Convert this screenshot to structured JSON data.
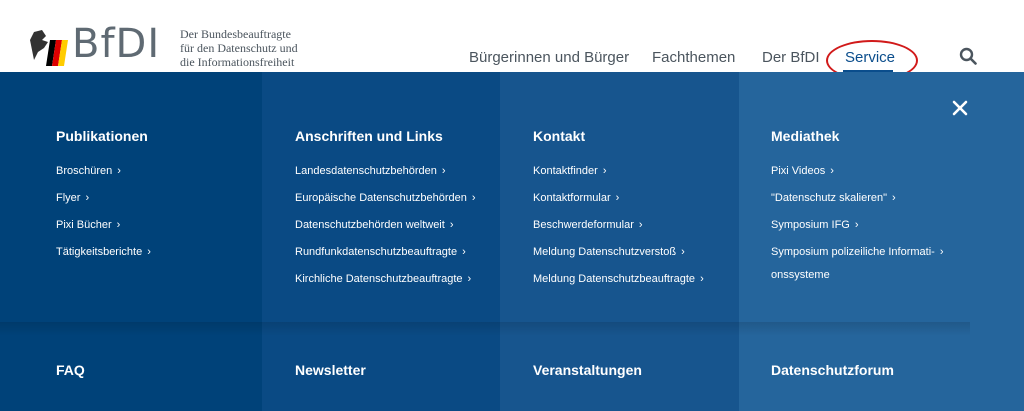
{
  "header": {
    "logo_text": "BfDI",
    "tagline": [
      "Der Bundesbeauftragte",
      "für den Datenschutz und",
      "die Informationsfreiheit"
    ]
  },
  "nav": {
    "items": [
      {
        "label": "Bürgerinnen und Bürger"
      },
      {
        "label": "Fachthemen"
      },
      {
        "label": "Der BfDI"
      },
      {
        "label": "Service"
      }
    ],
    "active": "Service"
  },
  "menu": {
    "columns": [
      {
        "title": "Publikationen",
        "links": [
          "Broschüren",
          "Flyer",
          "Pixi Bücher",
          "Tätigkeitsberichte"
        ]
      },
      {
        "title": "Anschriften und Links",
        "links": [
          "Landesdatenschutzbehörden",
          "Europäische Datenschutzbehörden",
          "Datenschutzbehörden weltweit",
          "Rundfunkdatenschutzbeauftragte",
          "Kirchliche Datenschutzbeauftragte"
        ]
      },
      {
        "title": "Kontakt",
        "links": [
          "Kontaktfinder",
          "Kontaktformular",
          "Beschwerdeformular",
          "Meldung Datenschutzverstoß",
          "Meldung Datenschutzbeauftragte"
        ]
      },
      {
        "title": "Mediathek",
        "links": [
          "Pixi Videos",
          "\"Datenschutz skalieren\"",
          "Symposium IFG"
        ],
        "multiline_link": {
          "line1": "Symposium polizeiliche Informati-",
          "line2": "onssysteme"
        }
      }
    ],
    "bottom": [
      "FAQ",
      "Newsletter",
      "Veranstaltungen",
      "Datenschutzforum"
    ],
    "chevron": "›",
    "colors": {
      "col0": "#004279",
      "col1": "#0a4a84",
      "col2": "#17558e",
      "col3": "#25659c",
      "highlight_circle": "#d11a1a"
    }
  }
}
